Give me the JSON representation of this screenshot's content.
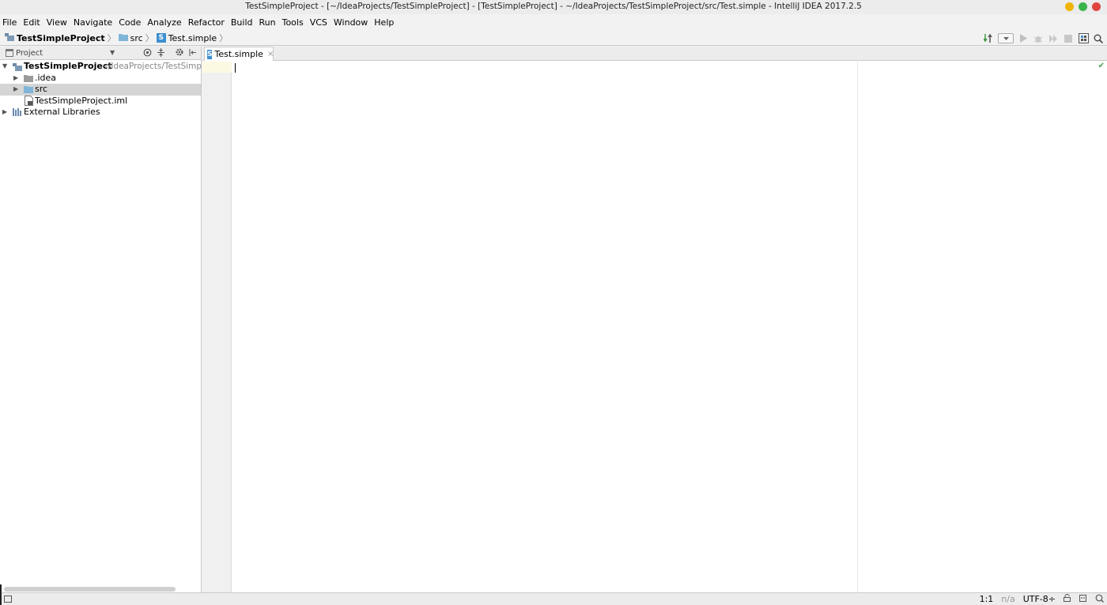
{
  "window": {
    "title": "TestSimpleProject - [~/IdeaProjects/TestSimpleProject] - [TestSimpleProject] - ~/IdeaProjects/TestSimpleProject/src/Test.simple - IntelliJ IDEA 2017.2.5",
    "controls": [
      {
        "name": "minimize",
        "color": "#f0b400"
      },
      {
        "name": "maximize",
        "color": "#39b54a"
      },
      {
        "name": "close",
        "color": "#e0443e"
      }
    ]
  },
  "menu": [
    "File",
    "Edit",
    "View",
    "Navigate",
    "Code",
    "Analyze",
    "Refactor",
    "Build",
    "Run",
    "Tools",
    "VCS",
    "Window",
    "Help"
  ],
  "breadcrumb": {
    "project": "TestSimpleProject",
    "folder": "src",
    "file": "Test.simple",
    "file_icon_letter": "S"
  },
  "toolbar_icons": [
    "build-icon",
    "run-config-dropdown",
    "run-icon",
    "debug-icon",
    "coverage-icon",
    "stop-icon",
    "project-structure-icon",
    "search-everywhere-icon"
  ],
  "project_panel": {
    "title": "Project",
    "tree": [
      {
        "label": "TestSimpleProject",
        "path": "~/IdeaProjects/TestSimple",
        "bold": true,
        "expanded": true,
        "level": 0,
        "icon": "module-icon"
      },
      {
        "label": ".idea",
        "level": 1,
        "icon": "folder-icon",
        "collapsed": true
      },
      {
        "label": "src",
        "level": 1,
        "icon": "folder-icon",
        "collapsed": true,
        "selected": true
      },
      {
        "label": "TestSimpleProject.iml",
        "level": 1,
        "icon": "iml-file-icon"
      },
      {
        "label": "External Libraries",
        "level": 0,
        "icon": "libraries-icon",
        "collapsed": true
      }
    ]
  },
  "editor": {
    "tab_label": "Test.simple",
    "tab_icon_letter": "S",
    "tab_close": "×"
  },
  "status": {
    "position": "1:1",
    "line_separator": "n/a",
    "encoding": "UTF-8÷"
  },
  "colors": {
    "accent_blue": "#3d8fd1",
    "folder_blue": "#7fb5d9",
    "selection": "#d5d5d5"
  }
}
